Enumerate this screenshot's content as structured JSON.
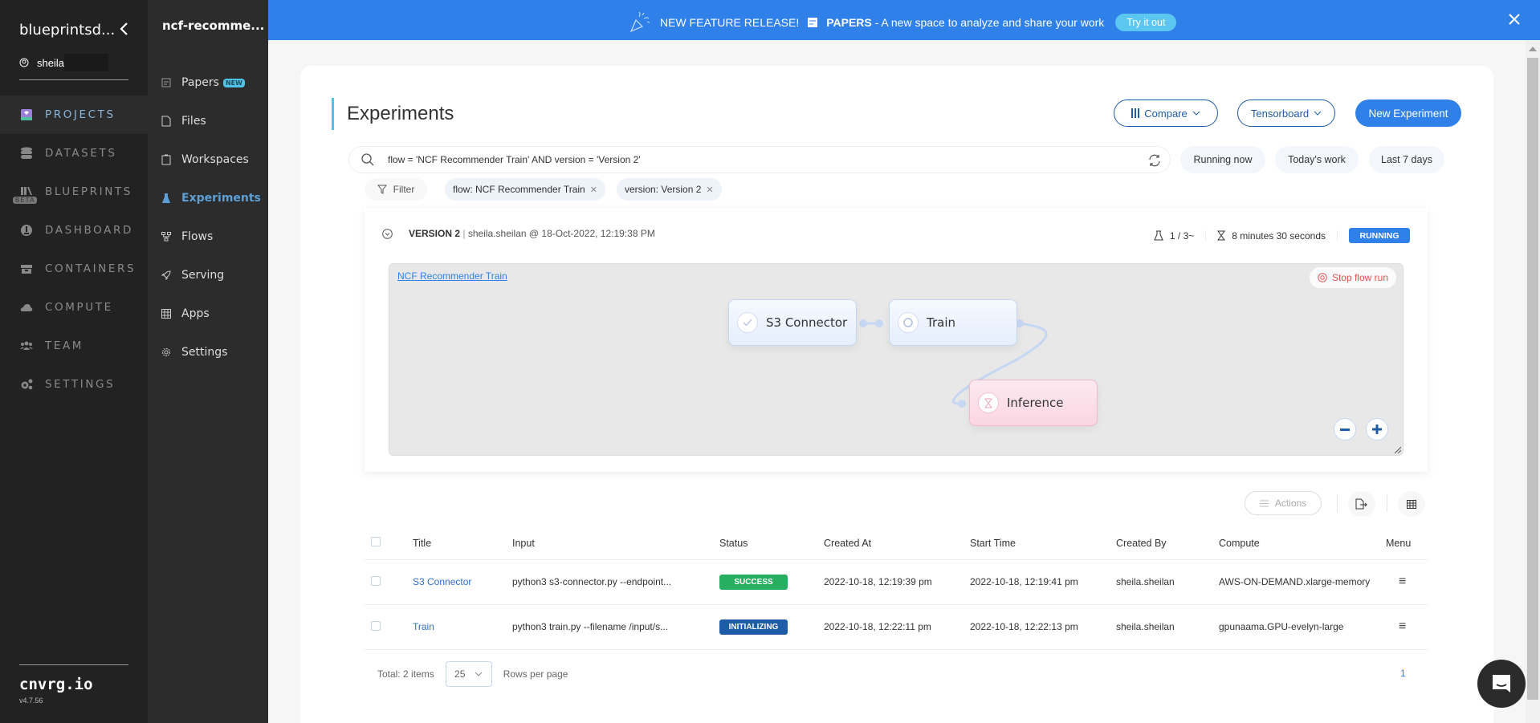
{
  "sidebar": {
    "org_name": "blueprintsd...",
    "username": "sheila",
    "nav": [
      {
        "label": "PROJECTS",
        "icon": "projects-icon",
        "active": true
      },
      {
        "label": "DATASETS",
        "icon": "database-icon"
      },
      {
        "label": "BLUEPRINTS",
        "icon": "blueprints-icon",
        "badge": "BETA"
      },
      {
        "label": "DASHBOARD",
        "icon": "dashboard-icon"
      },
      {
        "label": "CONTAINERS",
        "icon": "containers-icon"
      },
      {
        "label": "COMPUTE",
        "icon": "cloud-icon"
      },
      {
        "label": "TEAM",
        "icon": "team-icon"
      },
      {
        "label": "SETTINGS",
        "icon": "gears-icon"
      }
    ],
    "brand": "cnvrg.io",
    "version": "v4.7.56"
  },
  "project": {
    "title": "ncf-recomme...",
    "items": [
      {
        "label": "Papers",
        "badge": "NEW",
        "icon": "papers-icon"
      },
      {
        "label": "Files",
        "icon": "file-icon"
      },
      {
        "label": "Workspaces",
        "icon": "workspace-icon"
      },
      {
        "label": "Experiments",
        "icon": "flask-icon",
        "active": true
      },
      {
        "label": "Flows",
        "icon": "flow-icon"
      },
      {
        "label": "Serving",
        "icon": "rocket-icon"
      },
      {
        "label": "Apps",
        "icon": "grid-icon"
      },
      {
        "label": "Settings",
        "icon": "gear-icon"
      }
    ]
  },
  "banner": {
    "headline": "NEW FEATURE RELEASE!",
    "feature": "PAPERS",
    "description": "- A new space to analyze and share your work",
    "cta": "Try it out"
  },
  "header": {
    "title": "Experiments",
    "compare": "Compare",
    "tensorboard": "Tensorboard",
    "new_experiment": "New Experiment"
  },
  "search": {
    "query": "flow = 'NCF Recommender Train' AND version = 'Version 2'",
    "quick_filters": [
      "Running now",
      "Today's work",
      "Last 7 days"
    ],
    "filter_label": "Filter",
    "chips": [
      "flow: NCF Recommender Train",
      "version: Version 2"
    ]
  },
  "version": {
    "name": "VERSION 2",
    "meta": "sheila.sheilan @ 18-Oct-2022, 12:19:38 PM",
    "progress": "1 / 3~",
    "duration": "8 minutes 30 seconds",
    "status": "RUNNING",
    "status_color": "#2f80e8",
    "flow_name": "NCF Recommender Train",
    "stop_label": "Stop flow run",
    "nodes": [
      {
        "label": "S3 Connector",
        "state": "success"
      },
      {
        "label": "Train",
        "state": "running"
      },
      {
        "label": "Inference",
        "state": "pending"
      }
    ]
  },
  "table": {
    "actions_label": "Actions",
    "columns": [
      "Title",
      "Input",
      "Status",
      "Created At",
      "Start Time",
      "Created By",
      "Compute",
      "Menu"
    ],
    "rows": [
      {
        "title": "S3 Connector",
        "input": "python3 s3-connector.py --endpoint...",
        "status": "SUCCESS",
        "status_color": "#27ae60",
        "created_at": "2022-10-18, 12:19:39 pm",
        "start_time": "2022-10-18, 12:19:41 pm",
        "created_by": "sheila.sheilan",
        "compute": "AWS-ON-DEMAND.xlarge-memory"
      },
      {
        "title": "Train",
        "input": "python3 train.py --filename /input/s...",
        "status": "INITIALIZING",
        "status_color": "#1f5ca8",
        "created_at": "2022-10-18, 12:22:11 pm",
        "start_time": "2022-10-18, 12:22:13 pm",
        "created_by": "sheila.sheilan",
        "compute": "gpunaama.GPU-evelyn-large"
      }
    ],
    "total": "Total: 2 items",
    "rows_per_page": "25",
    "rows_per_page_label": "Rows per page",
    "page": "1"
  }
}
